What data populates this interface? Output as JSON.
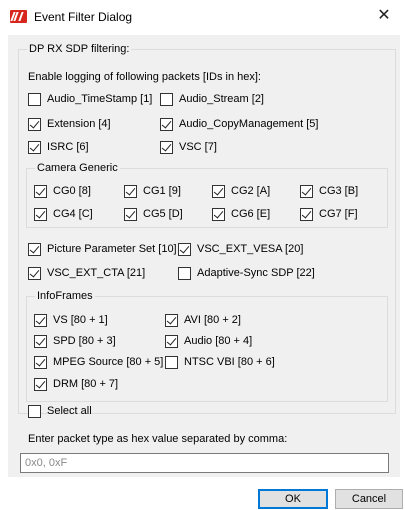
{
  "window": {
    "title": "Event Filter Dialog",
    "close_glyph": "✕"
  },
  "dp_group": {
    "label": "DP RX SDP filtering:"
  },
  "enable_label": "Enable logging of following packets [IDs in hex]:",
  "packets": [
    {
      "label": "Audio_TimeStamp [1]",
      "checked": false
    },
    {
      "label": "Audio_Stream [2]",
      "checked": false
    },
    {
      "label": "Extension [4]",
      "checked": true
    },
    {
      "label": "Audio_CopyManagement [5]",
      "checked": true
    },
    {
      "label": "ISRC [6]",
      "checked": true
    },
    {
      "label": "VSC [7]",
      "checked": true
    }
  ],
  "camera_generic": {
    "label": "Camera Generic",
    "items": [
      {
        "label": "CG0 [8]",
        "checked": true
      },
      {
        "label": "CG1 [9]",
        "checked": true
      },
      {
        "label": "CG2 [A]",
        "checked": true
      },
      {
        "label": "CG3 [B]",
        "checked": true
      },
      {
        "label": "CG4 [C]",
        "checked": true
      },
      {
        "label": "CG5 [D]",
        "checked": true
      },
      {
        "label": "CG6 [E]",
        "checked": true
      },
      {
        "label": "CG7 [F]",
        "checked": true
      }
    ]
  },
  "more_packets": [
    {
      "label": "Picture Parameter Set [10]",
      "checked": true
    },
    {
      "label": "VSC_EXT_VESA [20]",
      "checked": true
    },
    {
      "label": "VSC_EXT_CTA [21]",
      "checked": true
    },
    {
      "label": "Adaptive-Sync SDP [22]",
      "checked": false
    }
  ],
  "infoframes": {
    "label": "InfoFrames",
    "items": [
      {
        "label": "VS [80 + 1]",
        "checked": true
      },
      {
        "label": "AVI [80 + 2]",
        "checked": true
      },
      {
        "label": "SPD [80 + 3]",
        "checked": true
      },
      {
        "label": "Audio [80 + 4]",
        "checked": true
      },
      {
        "label": "MPEG Source [80 + 5]",
        "checked": true
      },
      {
        "label": "NTSC VBI [80 + 6]",
        "checked": false
      },
      {
        "label": "DRM [80 + 7]",
        "checked": true
      }
    ]
  },
  "select_all": {
    "label": "Select all",
    "checked": false
  },
  "hex_entry": {
    "label": "Enter packet type as hex value separated by comma:",
    "value": "",
    "placeholder": "0x0, 0xF"
  },
  "buttons": {
    "ok": "OK",
    "cancel": "Cancel"
  },
  "colors": {
    "logo": "#d7261e",
    "accent": "#0078d7",
    "client_bg": "#f0f0f0"
  }
}
